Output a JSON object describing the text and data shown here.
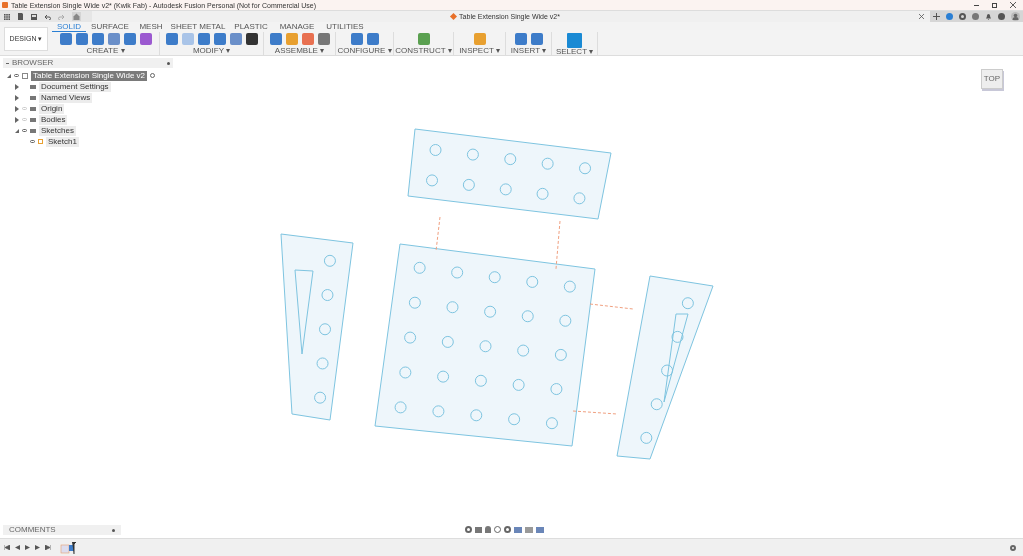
{
  "window": {
    "title": "Table Extension Single Wide v2* (Kwik Fab) - Autodesk Fusion Personal (Not for Commercial Use)"
  },
  "document_tab": {
    "title": "Table Extension Single Wide v2*"
  },
  "workspace": {
    "label": "DESIGN ▾"
  },
  "tabs": [
    {
      "label": "SOLID",
      "selected": true
    },
    {
      "label": "SURFACE",
      "selected": false
    },
    {
      "label": "MESH",
      "selected": false
    },
    {
      "label": "SHEET METAL",
      "selected": false
    },
    {
      "label": "PLASTIC",
      "selected": false
    },
    {
      "label": "MANAGE",
      "selected": false
    },
    {
      "label": "UTILITIES",
      "selected": false
    }
  ],
  "toolbar_groups": [
    {
      "label": "CREATE ▾"
    },
    {
      "label": "MODIFY ▾"
    },
    {
      "label": "ASSEMBLE ▾"
    },
    {
      "label": "CONFIGURE ▾"
    },
    {
      "label": "CONSTRUCT ▾"
    },
    {
      "label": "INSPECT ▾"
    },
    {
      "label": "INSERT ▾"
    },
    {
      "label": "SELECT ▾"
    }
  ],
  "browser": {
    "title": "BROWSER",
    "tree": [
      {
        "label": "Table Extension Single Wide v2",
        "selected": true,
        "expanded": true,
        "visible": true,
        "children": [
          {
            "label": "Document Settings",
            "selected": false,
            "expanded": false
          },
          {
            "label": "Named Views",
            "selected": false,
            "expanded": false
          },
          {
            "label": "Origin",
            "selected": false,
            "expanded": false,
            "visible": false
          },
          {
            "label": "Bodies",
            "selected": false,
            "expanded": false,
            "visible": false
          },
          {
            "label": "Sketches",
            "selected": false,
            "expanded": true,
            "visible": true,
            "children": [
              {
                "label": "Sketch1",
                "selected": false,
                "visible": true
              }
            ]
          }
        ]
      }
    ]
  },
  "view_cube": {
    "label": "TOP"
  },
  "comments": {
    "title": "COMMENTS"
  }
}
